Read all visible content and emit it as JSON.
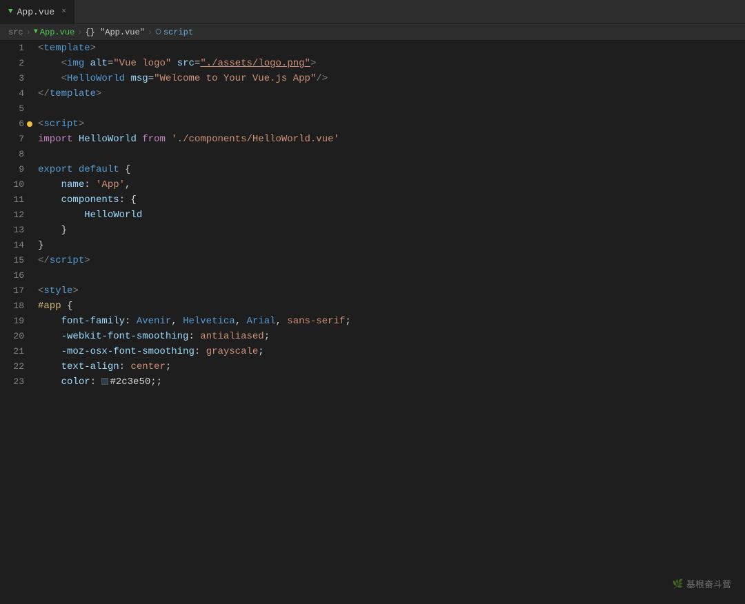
{
  "tab": {
    "icon": "▼",
    "label": "App.vue",
    "close": "×"
  },
  "breadcrumb": {
    "src": "src",
    "sep1": ">",
    "app_vue": "App.vue",
    "sep2": ">",
    "obj": "{} \"App.vue\"",
    "sep3": ">",
    "script": "script"
  },
  "lines": [
    {
      "num": "1",
      "tokens": [
        {
          "t": "tag",
          "v": "<"
        },
        {
          "t": "tag-name",
          "v": "template"
        },
        {
          "t": "tag",
          "v": ">"
        }
      ]
    },
    {
      "num": "2",
      "tokens": [
        {
          "t": "plain",
          "v": "    "
        },
        {
          "t": "tag",
          "v": "<"
        },
        {
          "t": "tag-name",
          "v": "img"
        },
        {
          "t": "plain",
          "v": " "
        },
        {
          "t": "attr-name",
          "v": "alt"
        },
        {
          "t": "attr-eq",
          "v": "="
        },
        {
          "t": "attr-val",
          "v": "\"Vue logo\""
        },
        {
          "t": "plain",
          "v": " "
        },
        {
          "t": "attr-name",
          "v": "src"
        },
        {
          "t": "attr-eq",
          "v": "="
        },
        {
          "t": "attr-val-link",
          "v": "\"./assets/logo.png\""
        },
        {
          "t": "tag",
          "v": ">"
        }
      ]
    },
    {
      "num": "3",
      "tokens": [
        {
          "t": "plain",
          "v": "    "
        },
        {
          "t": "tag",
          "v": "<"
        },
        {
          "t": "tag-name",
          "v": "HelloWorld"
        },
        {
          "t": "plain",
          "v": " "
        },
        {
          "t": "attr-name",
          "v": "msg"
        },
        {
          "t": "attr-eq",
          "v": "="
        },
        {
          "t": "attr-val",
          "v": "\"Welcome to Your Vue.js App\""
        },
        {
          "t": "self-close",
          "v": "/>"
        }
      ]
    },
    {
      "num": "4",
      "tokens": [
        {
          "t": "tag",
          "v": "</"
        },
        {
          "t": "tag-name",
          "v": "template"
        },
        {
          "t": "tag",
          "v": ">"
        }
      ]
    },
    {
      "num": "5",
      "tokens": []
    },
    {
      "num": "6",
      "tokens": [
        {
          "t": "tag",
          "v": "<"
        },
        {
          "t": "tag-name",
          "v": "script"
        },
        {
          "t": "tag",
          "v": ">"
        }
      ],
      "hasDot": true
    },
    {
      "num": "7",
      "tokens": [
        {
          "t": "import-kw",
          "v": "import"
        },
        {
          "t": "plain",
          "v": " "
        },
        {
          "t": "identifier",
          "v": "HelloWorld"
        },
        {
          "t": "plain",
          "v": " "
        },
        {
          "t": "keyword",
          "v": "from"
        },
        {
          "t": "plain",
          "v": " "
        },
        {
          "t": "string",
          "v": "'./components/HelloWorld.vue'"
        }
      ]
    },
    {
      "num": "8",
      "tokens": []
    },
    {
      "num": "9",
      "tokens": [
        {
          "t": "keyword-blue",
          "v": "export"
        },
        {
          "t": "plain",
          "v": " "
        },
        {
          "t": "keyword-blue",
          "v": "default"
        },
        {
          "t": "plain",
          "v": " {"
        }
      ]
    },
    {
      "num": "10",
      "tokens": [
        {
          "t": "plain",
          "v": "    "
        },
        {
          "t": "property",
          "v": "name"
        },
        {
          "t": "plain",
          "v": ": "
        },
        {
          "t": "string",
          "v": "'App'"
        },
        {
          "t": "plain",
          "v": ","
        }
      ]
    },
    {
      "num": "11",
      "tokens": [
        {
          "t": "plain",
          "v": "    "
        },
        {
          "t": "property",
          "v": "components"
        },
        {
          "t": "plain",
          "v": ": {"
        }
      ]
    },
    {
      "num": "12",
      "tokens": [
        {
          "t": "plain",
          "v": "        "
        },
        {
          "t": "identifier",
          "v": "HelloWorld"
        }
      ]
    },
    {
      "num": "13",
      "tokens": [
        {
          "t": "plain",
          "v": "    "
        },
        {
          "t": "plain",
          "v": "}"
        }
      ]
    },
    {
      "num": "14",
      "tokens": [
        {
          "t": "plain",
          "v": "}"
        }
      ]
    },
    {
      "num": "15",
      "tokens": [
        {
          "t": "tag",
          "v": "</"
        },
        {
          "t": "tag-name",
          "v": "script"
        },
        {
          "t": "tag",
          "v": ">"
        }
      ]
    },
    {
      "num": "16",
      "tokens": []
    },
    {
      "num": "17",
      "tokens": [
        {
          "t": "tag",
          "v": "<"
        },
        {
          "t": "tag-name",
          "v": "style"
        },
        {
          "t": "tag",
          "v": ">"
        }
      ]
    },
    {
      "num": "18",
      "tokens": [
        {
          "t": "css-selector",
          "v": "#app"
        },
        {
          "t": "plain",
          "v": " {"
        }
      ]
    },
    {
      "num": "19",
      "tokens": [
        {
          "t": "plain",
          "v": "    "
        },
        {
          "t": "css-prop",
          "v": "font-family"
        },
        {
          "t": "plain",
          "v": ": "
        },
        {
          "t": "css-val-blue",
          "v": "Avenir"
        },
        {
          "t": "plain",
          "v": ", "
        },
        {
          "t": "css-val-blue",
          "v": "Helvetica"
        },
        {
          "t": "plain",
          "v": ", "
        },
        {
          "t": "css-val-blue",
          "v": "Arial"
        },
        {
          "t": "plain",
          "v": ", "
        },
        {
          "t": "css-val",
          "v": "sans-serif"
        },
        {
          "t": "plain",
          "v": ";"
        }
      ]
    },
    {
      "num": "20",
      "tokens": [
        {
          "t": "plain",
          "v": "    "
        },
        {
          "t": "css-dash",
          "v": "-webkit-font-smoothing"
        },
        {
          "t": "plain",
          "v": ": "
        },
        {
          "t": "css-val",
          "v": "antialiased"
        },
        {
          "t": "plain",
          "v": ";"
        }
      ]
    },
    {
      "num": "21",
      "tokens": [
        {
          "t": "plain",
          "v": "    "
        },
        {
          "t": "css-dash",
          "v": "-moz-osx-font-smoothing"
        },
        {
          "t": "plain",
          "v": ": "
        },
        {
          "t": "css-val",
          "v": "grayscale"
        },
        {
          "t": "plain",
          "v": ";"
        }
      ]
    },
    {
      "num": "22",
      "tokens": [
        {
          "t": "plain",
          "v": "    "
        },
        {
          "t": "css-prop",
          "v": "text-align"
        },
        {
          "t": "plain",
          "v": ": "
        },
        {
          "t": "css-val",
          "v": "center"
        },
        {
          "t": "plain",
          "v": ";"
        }
      ]
    },
    {
      "num": "23",
      "tokens": [
        {
          "t": "plain",
          "v": "    "
        },
        {
          "t": "css-prop",
          "v": "color"
        },
        {
          "t": "plain",
          "v": ": "
        },
        {
          "t": "hex-box",
          "v": "#2c3e50"
        },
        {
          "t": "plain",
          "v": ";"
        }
      ]
    }
  ],
  "watermark": {
    "icon": "🌿",
    "text": "基根奋斗营"
  }
}
